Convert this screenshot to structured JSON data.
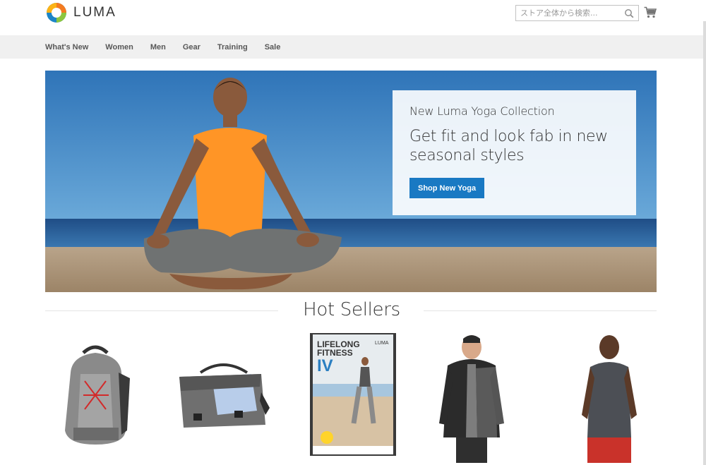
{
  "header": {
    "logo_text": "LUMA",
    "search_placeholder": "ストア全体から検索...",
    "icons": {
      "search": "search-icon",
      "cart": "cart-icon"
    }
  },
  "nav": {
    "items": [
      "What's New",
      "Women",
      "Men",
      "Gear",
      "Training",
      "Sale"
    ]
  },
  "hero": {
    "subtitle": "New Luma Yoga Collection",
    "title": "Get fit and look fab in new seasonal styles",
    "button_label": "Shop New Yoga"
  },
  "hot_sellers": {
    "title": "Hot Sellers",
    "products": [
      {
        "image": "gray-backpack"
      },
      {
        "image": "messenger-bag"
      },
      {
        "image": "lifelong-fitness-iv-dvd"
      },
      {
        "image": "man-hooded-jacket"
      },
      {
        "image": "man-sleeveless-tank"
      }
    ],
    "dvd_cover": {
      "title_line1": "LIFELONG",
      "title_line2": "FITNESS",
      "title_line3": "IV",
      "brand": "LUMA"
    }
  },
  "colors": {
    "accent_button": "#1979c3",
    "nav_background": "#f0f0f0",
    "logo_orange": "#f47b20",
    "logo_blue": "#1c85c6",
    "logo_green": "#8dc63f"
  }
}
